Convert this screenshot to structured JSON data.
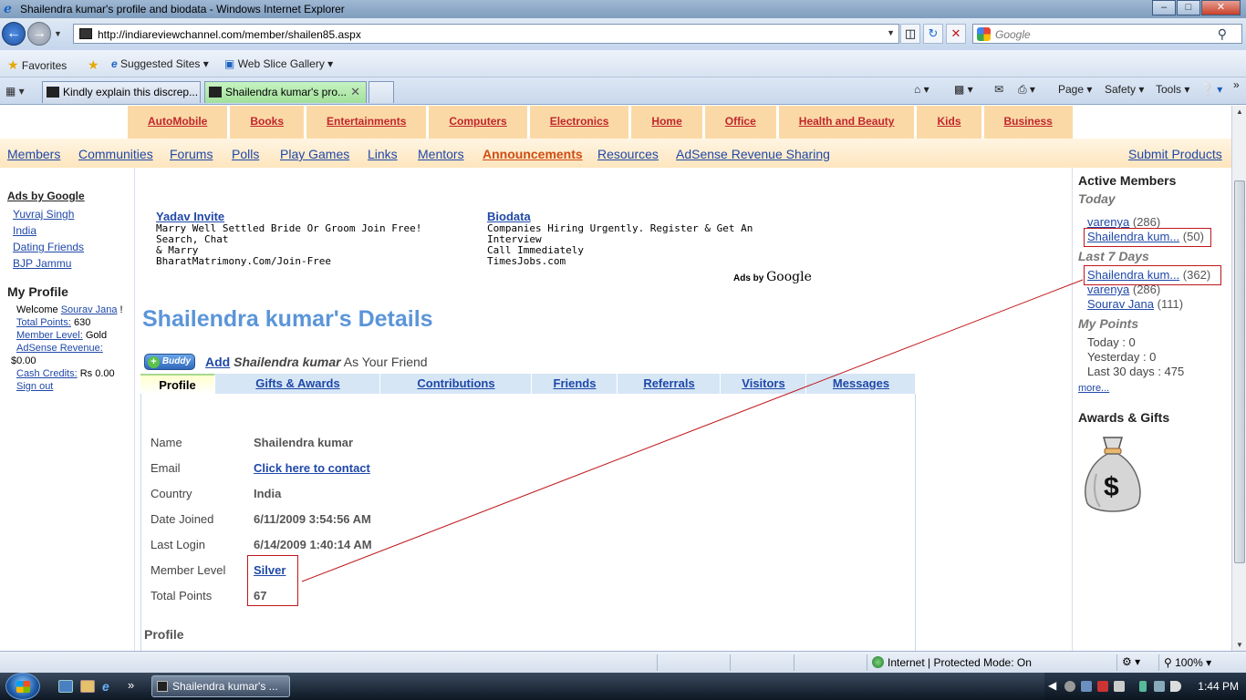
{
  "window": {
    "title": "Shailendra kumar's profile and biodata - Windows Internet Explorer"
  },
  "browser": {
    "url": "http://indiareviewchannel.com/member/shailen85.aspx",
    "search_placeholder": "Google",
    "favorites_label": "Favorites",
    "suggested_sites": "Suggested Sites",
    "web_slice_gallery": "Web Slice Gallery",
    "tabs": [
      {
        "label": "Kindly explain this discrep..."
      },
      {
        "label": "Shailendra kumar's pro..."
      }
    ],
    "commands": {
      "page": "Page",
      "safety": "Safety",
      "tools": "Tools"
    }
  },
  "site": {
    "categories": [
      "AutoMobile",
      "Books",
      "Entertainments",
      "Computers",
      "Electronics",
      "Home ",
      "Office ",
      "Health and Beauty",
      "Kids",
      "Business"
    ],
    "subnav": [
      "Members",
      "Communities",
      "Forums",
      "Polls",
      "Play Games",
      "Links",
      "Mentors",
      "Announcements",
      "Resources",
      "AdSense Revenue Sharing"
    ],
    "submit_products": "Submit Products"
  },
  "left": {
    "ads_heading": "Ads by Google",
    "ad_links": [
      "Yuvraj Singh",
      "India",
      "Dating Friends",
      "BJP Jammu"
    ],
    "my_profile": "My Profile",
    "welcome": "Welcome",
    "user": "Sourav Jana",
    "exclaim": "!",
    "total_points_label": "Total Points:",
    "total_points": "630",
    "member_level_label": "Member Level:",
    "member_level": "Gold",
    "adsense_label": "AdSense Revenue:",
    "adsense_value": "$0.00",
    "cash_label": "Cash Credits:",
    "cash_value": "Rs 0.00",
    "sign_out": "Sign out"
  },
  "ads": [
    {
      "title": "Yadav Invite",
      "line1": "Marry Well Settled Bride Or Groom Join Free! Search, Chat",
      "line2": "& Marry",
      "url": "BharatMatrimony.Com/Join-Free"
    },
    {
      "title": "Biodata",
      "line1": "Companies Hiring Urgently. Register & Get An Interview",
      "line2": "Call Immediately",
      "url": "TimesJobs.com"
    }
  ],
  "ads_by": "Ads by",
  "ads_by_brand": "Google",
  "profile": {
    "heading": "Shailendra kumar's Details",
    "buddy_label": "Buddy",
    "add_link": "Add",
    "add_name": "Shailendra kumar",
    "add_suffix": "As Your Friend",
    "tabs": [
      "Profile",
      "Gifts & Awards",
      "Contributions",
      "Friends",
      "Referrals",
      "Visitors",
      "Messages"
    ],
    "fields": [
      {
        "label": "Name",
        "value": "Shailendra kumar"
      },
      {
        "label": "Email",
        "value": "Click here to contact"
      },
      {
        "label": "Country",
        "value": "India"
      },
      {
        "label": "Date Joined",
        "value": "6/11/2009 3:54:56 AM"
      },
      {
        "label": "Last Login",
        "value": "6/14/2009 1:40:14 AM"
      },
      {
        "label": "Member Level",
        "value": "Silver"
      },
      {
        "label": "Total Points",
        "value": "67"
      }
    ],
    "section_profile": "Profile"
  },
  "right": {
    "active_members": "Active Members",
    "today": "Today",
    "today_members": [
      {
        "name": "varenya",
        "count": "(286)"
      },
      {
        "name": "Shailendra kum...",
        "count": "(50)"
      }
    ],
    "last7": "Last 7 Days",
    "week_members": [
      {
        "name": "Shailendra kum...",
        "count": "(362)"
      },
      {
        "name": "varenya",
        "count": "(286)"
      },
      {
        "name": "Sourav Jana",
        "count": "(111)"
      }
    ],
    "my_points": "My Points",
    "points": [
      "Today : 0",
      "Yesterday : 0",
      "Last 30 days : 475"
    ],
    "more": "more...",
    "awards": "Awards & Gifts",
    "moneybag_symbol": "$"
  },
  "status": {
    "zone": "Internet | Protected Mode: On",
    "zoom": "100%"
  },
  "taskbar": {
    "app": "Shailendra kumar's ...",
    "clock": "1:44 PM"
  }
}
